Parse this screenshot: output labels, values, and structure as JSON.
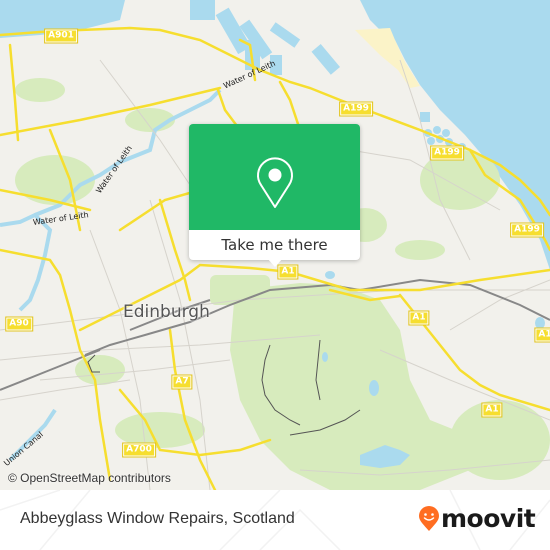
{
  "map": {
    "city_label": "Edinburgh",
    "attribution": "© OpenStreetMap contributors",
    "road_labels": [
      {
        "id": "a901",
        "text": "A901"
      },
      {
        "id": "a199-1",
        "text": "A199"
      },
      {
        "id": "a199-2",
        "text": "A199"
      },
      {
        "id": "a199-3",
        "text": "A199"
      },
      {
        "id": "a1-1",
        "text": "A1"
      },
      {
        "id": "a1-2",
        "text": "A1"
      },
      {
        "id": "a1-3",
        "text": "A1"
      },
      {
        "id": "a1-4",
        "text": "A1"
      },
      {
        "id": "a90",
        "text": "A90"
      },
      {
        "id": "a7",
        "text": "A7"
      },
      {
        "id": "a700",
        "text": "A700"
      }
    ],
    "water_labels": [
      {
        "id": "wol-1",
        "text": "Water of Leith"
      },
      {
        "id": "wol-2",
        "text": "Water of Leith"
      },
      {
        "id": "wol-3",
        "text": "Water of Leith"
      },
      {
        "id": "canal",
        "text": "Union Canal"
      }
    ],
    "colors": {
      "land": "#f2f1ec",
      "water": "#aadaee",
      "park": "#d7ebbd",
      "road": "#f6de2f",
      "sand": "#fbf3c8"
    }
  },
  "popup": {
    "button_label": "Take me there",
    "icon": "map-pin-icon",
    "accent_color": "#20b866"
  },
  "footer": {
    "place_title": "Abbeyglass Window Repairs, Scotland",
    "brand": "moovit",
    "brand_color": "#ff6d21"
  }
}
